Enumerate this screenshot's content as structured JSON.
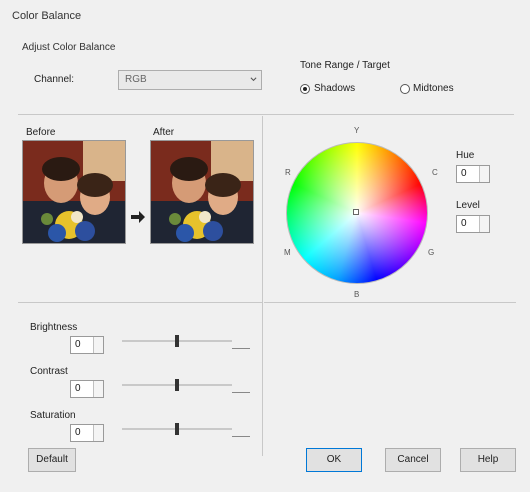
{
  "window": {
    "title": "Color Balance"
  },
  "adjust_group": {
    "label": "Adjust Color Balance"
  },
  "channel": {
    "label": "Channel:",
    "value": "RGB"
  },
  "target": {
    "label": "Tone Range / Target",
    "options": [
      {
        "label": "Shadows",
        "selected": true
      },
      {
        "label": "Midtones",
        "selected": false
      }
    ]
  },
  "preview": {
    "before_label": "Before",
    "after_label": "After"
  },
  "wheel": {
    "compass": {
      "top": "Y",
      "left": "R",
      "right": "C",
      "bottom": "B",
      "lower_left": "M",
      "lower_right": "G"
    }
  },
  "wheel_fields": [
    {
      "label": "Hue",
      "value": "0"
    },
    {
      "label": "Level",
      "value": "0"
    }
  ],
  "sliders": [
    {
      "label": "Brightness",
      "value": "0",
      "level": 0.5
    },
    {
      "label": "Contrast",
      "value": "0",
      "level": 0.5
    },
    {
      "label": "Saturation",
      "value": "0",
      "level": 0.5
    }
  ],
  "buttons": {
    "default": "Default",
    "ok": "OK",
    "cancel": "Cancel",
    "help": "Help"
  },
  "colors": {
    "accent": "#0078d7",
    "background": "#f0f0f0"
  }
}
